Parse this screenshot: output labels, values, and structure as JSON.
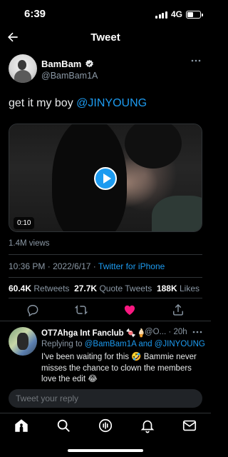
{
  "status_bar": {
    "time": "6:39",
    "network": "4G",
    "battery_level": 0.45
  },
  "nav": {
    "title": "Tweet"
  },
  "tweet": {
    "author_name": "BamBam",
    "author_handle": "@BamBam1A",
    "text_prefix": "get it my boy ",
    "mention": "@JINYOUNG",
    "video_duration": "0:10",
    "views": "1.4M views",
    "time": "10:36 PM",
    "date": "2022/6/17",
    "separator": "·",
    "source": "Twitter for iPhone",
    "stats": {
      "retweets_count": "60.4K",
      "retweets_label": "Retweets",
      "quote_tweets_count": "27.7K",
      "quote_tweets_label": "Quote Tweets",
      "likes_count": "188K",
      "likes_label": "Likes"
    },
    "liked": true
  },
  "reply": {
    "author_name": "OT7Ahga Int Fanclub 🍬🍦",
    "author_handle": "@O...",
    "separator": "·",
    "time": "20h",
    "replying_prefix": "Replying to ",
    "replying_user1": "@BamBam1A",
    "replying_and": " and ",
    "replying_user2": "@JINYOUNG",
    "body": "I've been waiting for this 🤣 Bammie never misses the chance to clown the members love the edit 😂"
  },
  "compose": {
    "placeholder": "Tweet your reply"
  },
  "colors": {
    "accent": "#1d9bf0",
    "like": "#f91880",
    "background": "#000000",
    "secondary_text": "#8b98a5"
  },
  "tabbar": {
    "tabs": [
      "home-icon",
      "search-icon",
      "spaces-icon",
      "notifications-icon",
      "messages-icon"
    ]
  }
}
